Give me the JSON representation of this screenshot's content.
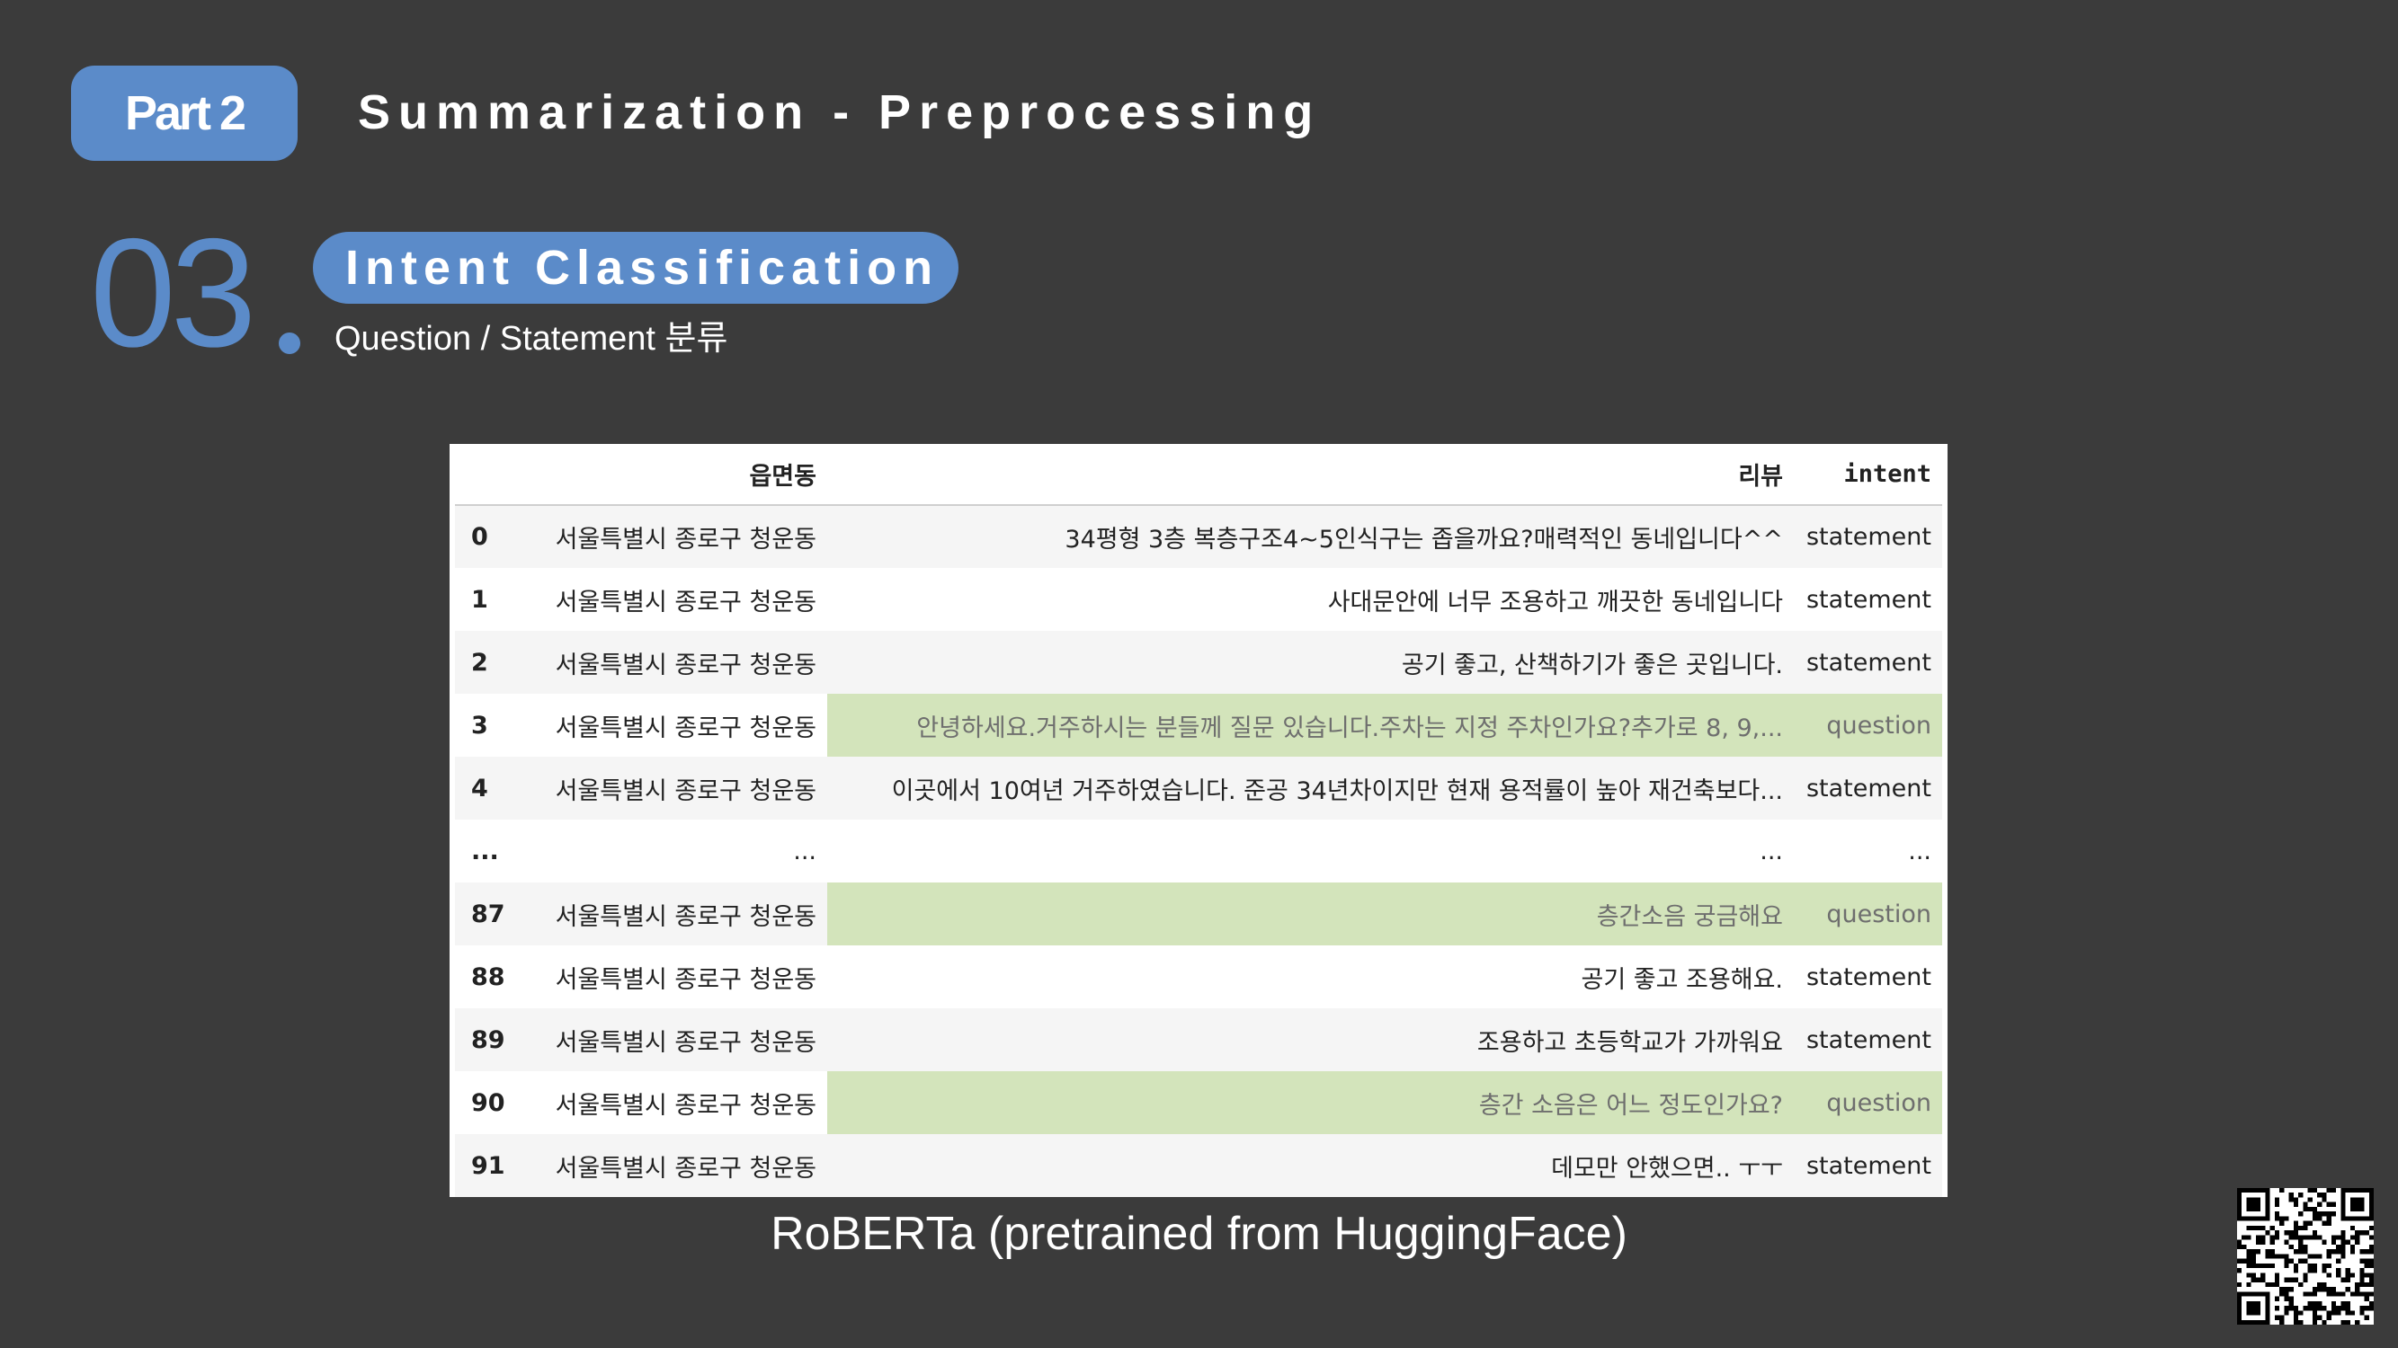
{
  "header": {
    "part_label": "Part 2",
    "title": "Summarization - Preprocessing"
  },
  "section": {
    "number": "03",
    "badge_title": "Intent Classification",
    "subtitle": "Question / Statement 분류"
  },
  "table": {
    "columns": [
      "",
      "읍면동",
      "리뷰",
      "intent"
    ],
    "rows": [
      {
        "index": "0",
        "town": "서울특별시 종로구 청운동",
        "review": "34평형 3층 복층구조4~5인식구는 좁을까요?매력적인 동네입니다^^",
        "intent": "statement",
        "highlight": false
      },
      {
        "index": "1",
        "town": "서울특별시 종로구 청운동",
        "review": "사대문안에 너무 조용하고 깨끗한 동네입니다",
        "intent": "statement",
        "highlight": false
      },
      {
        "index": "2",
        "town": "서울특별시 종로구 청운동",
        "review": "공기 좋고, 산책하기가 좋은 곳입니다.",
        "intent": "statement",
        "highlight": false
      },
      {
        "index": "3",
        "town": "서울특별시 종로구 청운동",
        "review": "안녕하세요.거주하시는 분들께 질문 있습니다.주차는 지정 주차인가요?추가로 8, 9,...",
        "intent": "question",
        "highlight": true
      },
      {
        "index": "4",
        "town": "서울특별시 종로구 청운동",
        "review": "이곳에서 10여년 거주하였습니다. 준공 34년차이지만 현재 용적률이 높아 재건축보다...",
        "intent": "statement",
        "highlight": false
      },
      {
        "index": "...",
        "town": "...",
        "review": "...",
        "intent": "...",
        "highlight": false
      },
      {
        "index": "87",
        "town": "서울특별시 종로구 청운동",
        "review": "층간소음 궁금해요",
        "intent": "question",
        "highlight": true
      },
      {
        "index": "88",
        "town": "서울특별시 종로구 청운동",
        "review": "공기 좋고 조용해요.",
        "intent": "statement",
        "highlight": false
      },
      {
        "index": "89",
        "town": "서울특별시 종로구 청운동",
        "review": "조용하고 초등학교가 가까워요",
        "intent": "statement",
        "highlight": false
      },
      {
        "index": "90",
        "town": "서울특별시 종로구 청운동",
        "review": "층간 소음은 어느 정도인가요?",
        "intent": "question",
        "highlight": true
      },
      {
        "index": "91",
        "town": "서울특별시 종로구 청운동",
        "review": "데모만 안했으면.. ㅜㅜ",
        "intent": "statement",
        "highlight": false
      }
    ]
  },
  "caption": "RoBERTa (pretrained from HuggingFace)",
  "colors": {
    "background": "#3b3b3b",
    "accent": "#5b8bc9",
    "highlight": "#d3e4bb"
  },
  "icons": {
    "qr": "qr-code-icon"
  }
}
